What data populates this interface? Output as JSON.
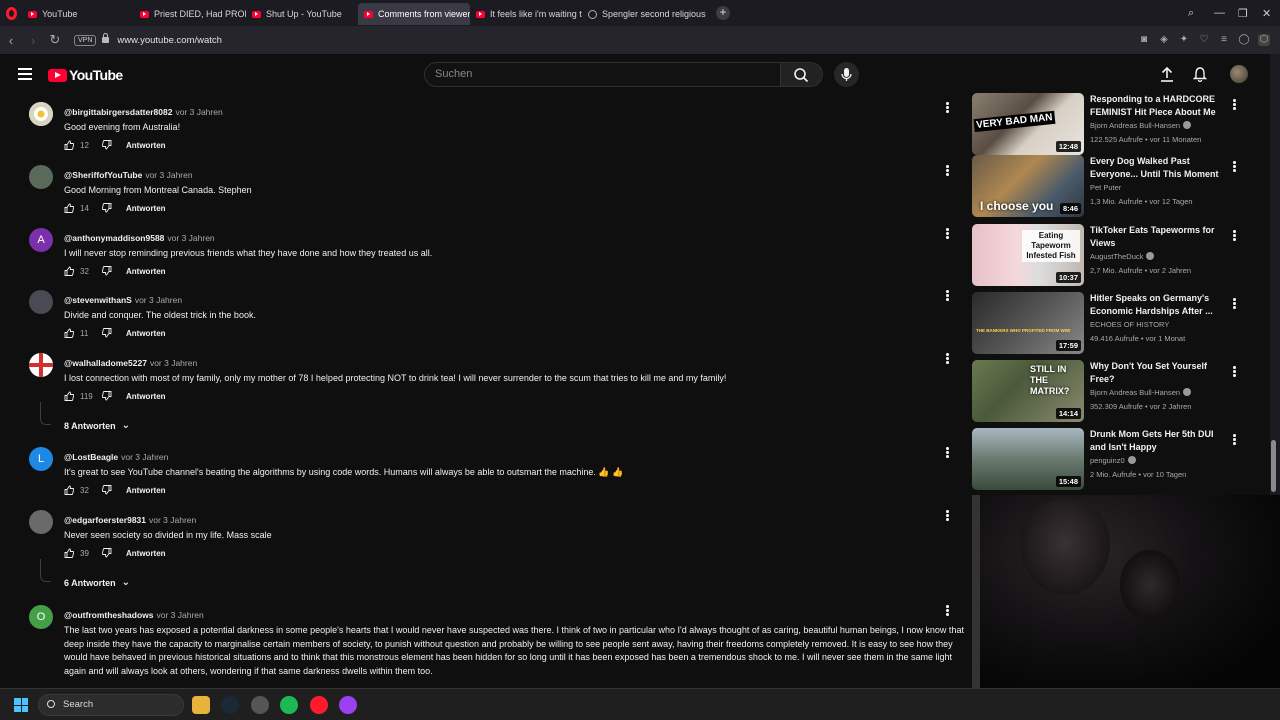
{
  "browser": {
    "tabs": [
      {
        "label": "YouTube",
        "icon": "youtube-favicon",
        "active": false
      },
      {
        "label": "Priest DIED, Had PROFOUN",
        "icon": "youtube-favicon",
        "active": false
      },
      {
        "label": "Shut Up - YouTube",
        "icon": "youtube-favicon",
        "active": false
      },
      {
        "label": "Comments from viewers",
        "icon": "youtube-favicon",
        "active": true
      },
      {
        "label": "It feels like i'm waiting to",
        "icon": "youtube-favicon",
        "active": false
      },
      {
        "label": "Spengler second religious",
        "icon": "globe-icon",
        "active": false
      }
    ],
    "vpn_label": "VPN",
    "url": "www.youtube.com/watch"
  },
  "youtube": {
    "logo_text": "YouTube",
    "search_placeholder": "Suchen"
  },
  "comments": [
    {
      "user": "@birgittabirgersdatter8082",
      "time": "vor 3 Jahren",
      "text": "Good evening from Australia!",
      "likes": "12",
      "reply_label": "Antworten",
      "avatar_letter": "",
      "avatar_color": "#e8e0c0"
    },
    {
      "user": "@SheriffofYouTube",
      "time": "vor 3 Jahren",
      "text": "Good Morning from Montreal Canada.   Stephen",
      "likes": "14",
      "reply_label": "Antworten",
      "avatar_letter": "",
      "avatar_color": "#5a6a5a"
    },
    {
      "user": "@anthonymaddison9588",
      "time": "vor 3 Jahren",
      "text": "I will never stop reminding previous friends what they have done and how they treated us all.",
      "likes": "32",
      "reply_label": "Antworten",
      "avatar_letter": "A",
      "avatar_color": "#7b2fa8"
    },
    {
      "user": "@stevenwithanS",
      "time": "vor 3 Jahren",
      "text": "Divide and conquer. The oldest trick in the book.",
      "likes": "11",
      "reply_label": "Antworten",
      "avatar_letter": "",
      "avatar_color": "#4a4a55"
    },
    {
      "user": "@walhalladome5227",
      "time": "vor 3 Jahren",
      "text": "I lost connection with most of my family, only my mother of 78 I helped protecting NOT to drink tea! I will never surrender to the scum that tries to kill me and my family!",
      "likes": "119",
      "reply_label": "Antworten",
      "avatar_letter": "",
      "avatar_color": "#ffffff",
      "replies": "8 Antworten"
    },
    {
      "user": "@LostBeagle",
      "time": "vor 3 Jahren",
      "text": "It's great to see YouTube channel's beating the algorithms by using code words. Humans will always be able to outsmart the machine. 👍 👍",
      "likes": "32",
      "reply_label": "Antworten",
      "avatar_letter": "L",
      "avatar_color": "#1e88e5"
    },
    {
      "user": "@edgarfoerster9831",
      "time": "vor 3 Jahren",
      "text": "Never seen society so divided in my life. Mass scale",
      "likes": "39",
      "reply_label": "Antworten",
      "avatar_letter": "",
      "avatar_color": "#6a6a6a",
      "replies": "6 Antworten"
    },
    {
      "user": "@outfromtheshadows",
      "time": "vor 3 Jahren",
      "text": "The last two years has exposed a potential darkness in some people's hearts that I would never have suspected was there. I think of two in particular who I'd always thought of as caring, beautiful human beings, I now know that deep inside they have the capacity to marginalise certain members of society, to punish without question and probably be willing to see people sent away, having their freedoms completely removed. It is easy to see how they would have behaved in previous historical situations and to think that this monstrous element has been hidden for so long until it has been exposed has been a tremendous shock to me. I will never see them in the same light again and will always look at others, wondering if that same darkness dwells within them too.",
      "likes": "",
      "reply_label": "",
      "avatar_letter": "O",
      "avatar_color": "#43a047"
    }
  ],
  "recommendations": [
    {
      "title": "Responding to a HARDCORE FEMINIST Hit Piece About Me",
      "channel": "Bjorn Andreas Bull-Hansen",
      "verified": true,
      "meta": "122.525 Aufrufe • vor 11 Monaten",
      "duration": "12:48",
      "overlay": "VERY BAD MAN"
    },
    {
      "title": "Every Dog Walked Past Everyone... Until This Moment",
      "channel": "Pet Puter",
      "verified": false,
      "meta": "1,3 Mio. Aufrufe • vor 12 Tagen",
      "duration": "8:46",
      "overlay": "I choose you"
    },
    {
      "title": "TikToker Eats Tapeworms for Views",
      "channel": "AugustTheDuck",
      "verified": true,
      "meta": "2,7 Mio. Aufrufe • vor 2 Jahren",
      "duration": "10:37",
      "overlay": "Eating Tapeworm Infested Fish"
    },
    {
      "title": "Hitler Speaks on Germany's Economic Hardships After ...",
      "channel": "ECHOES OF HISTORY",
      "verified": false,
      "meta": "49.416 Aufrufe • vor 1 Monat",
      "duration": "17:59",
      "overlay": "THE BANKERS WHO PROFITED FROM WWI"
    },
    {
      "title": "Why Don't You Set Yourself Free?",
      "channel": "Bjorn Andreas Bull-Hansen",
      "verified": true,
      "meta": "352.309 Aufrufe • vor 2 Jahren",
      "duration": "14:14",
      "overlay": "STILL IN THE MATRIX?"
    },
    {
      "title": "Drunk Mom Gets Her 5th DUI and Isn't Happy",
      "channel": "penguinz0",
      "verified": true,
      "meta": "2 Mio. Aufrufe • vor 10 Tagen",
      "duration": "15:48",
      "overlay": ""
    }
  ],
  "taskbar": {
    "search_label": "Search"
  }
}
